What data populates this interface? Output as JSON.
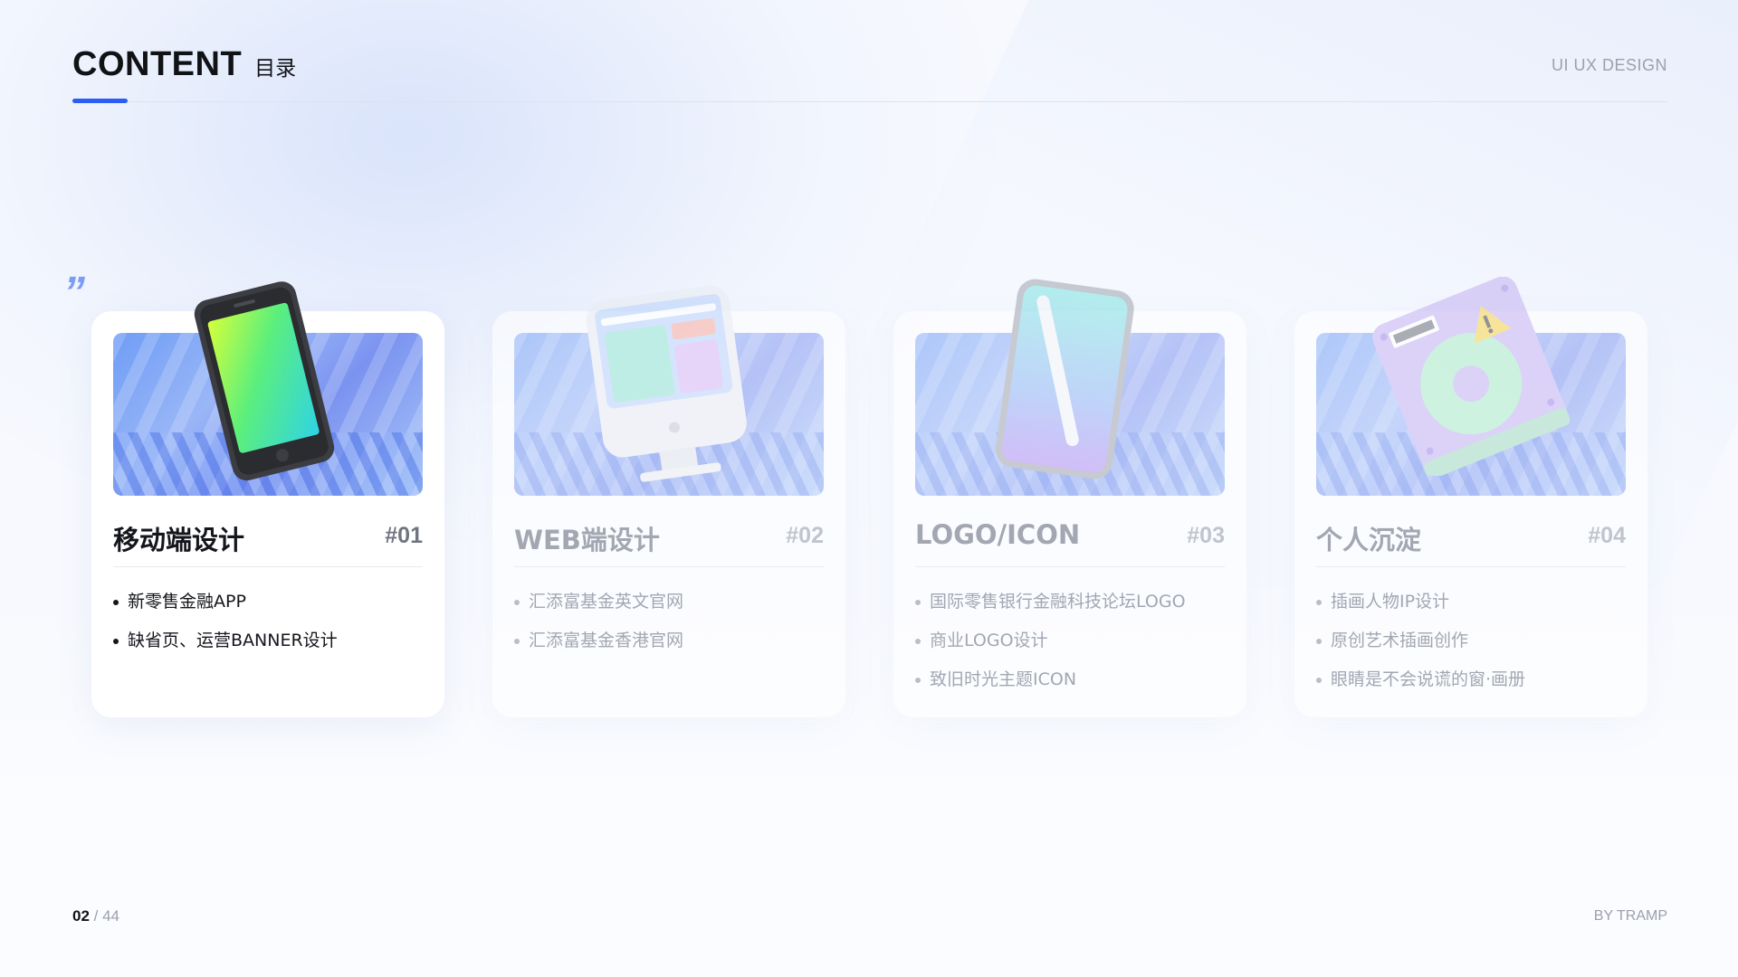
{
  "header": {
    "title_en": "CONTENT",
    "title_zh": "目录",
    "subtitle": "UI UX DESIGN",
    "accent_color": "#2a5df5"
  },
  "quote_mark": "”",
  "cards": [
    {
      "title": "移动端设计",
      "number": "#01",
      "icon": "smartphone-icon",
      "active": true,
      "items": [
        "新零售金融APP",
        "缺省页、运营BANNER设计"
      ]
    },
    {
      "title": "WEB端设计",
      "number": "#02",
      "icon": "desktop-monitor-icon",
      "active": false,
      "items": [
        "汇添富基金英文官网",
        "汇添富基金香港官网"
      ]
    },
    {
      "title": "LOGO/ICON",
      "number": "#03",
      "icon": "tablet-pen-icon",
      "active": false,
      "items": [
        "国际零售银行金融科技论坛LOGO",
        "商业LOGO设计",
        "致旧时光主题ICON"
      ]
    },
    {
      "title": "个人沉淀",
      "number": "#04",
      "icon": "hard-drive-icon",
      "active": false,
      "items": [
        "插画人物IP设计",
        "原创艺术插画创作",
        "眼睛是不会说谎的窗·画册"
      ]
    }
  ],
  "footer": {
    "page": "02",
    "separator": " / ",
    "total": "44",
    "author": "BY TRAMP"
  }
}
